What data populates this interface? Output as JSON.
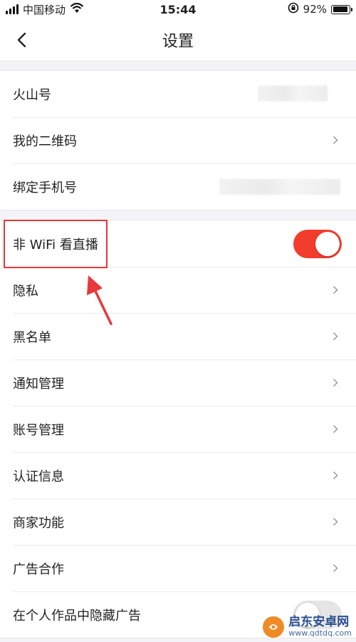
{
  "status_bar": {
    "carrier": "中国移动",
    "time": "15:44",
    "battery": "92%",
    "battery_level": 0.92,
    "icons": [
      "signal-icon",
      "wifi-icon",
      "orientation-lock-icon",
      "battery-icon"
    ]
  },
  "nav": {
    "title": "设置",
    "back_icon": "back-chevron-icon"
  },
  "account_group": {
    "items": [
      {
        "label": "火山号",
        "value_masked": true
      },
      {
        "label": "我的二维码",
        "chevron": true
      },
      {
        "label": "绑定手机号",
        "value_masked": true
      }
    ]
  },
  "settings_group": {
    "items": [
      {
        "label": "非 WiFi 看直播",
        "toggle": true,
        "toggle_on": true
      },
      {
        "label": "隐私",
        "chevron": true
      },
      {
        "label": "黑名单",
        "chevron": true
      },
      {
        "label": "通知管理",
        "chevron": true
      },
      {
        "label": "账号管理",
        "chevron": true
      },
      {
        "label": "认证信息",
        "chevron": true
      },
      {
        "label": "商家功能",
        "chevron": true
      },
      {
        "label": "广告合作",
        "chevron": true
      },
      {
        "label": "在个人作品中隐藏广告",
        "toggle": true,
        "toggle_on": false
      }
    ]
  },
  "colors": {
    "toggle_on": "#f23d2c",
    "toggle_off": "#e5e5e5",
    "highlight": "#e8383d",
    "watermark_blue": "#2a4f8f",
    "watermark_orange": "#f08a24"
  },
  "watermark": {
    "name": "启东安卓网",
    "url": "www.qdtdq.com"
  }
}
